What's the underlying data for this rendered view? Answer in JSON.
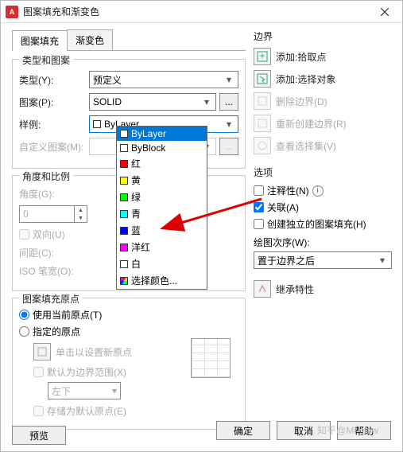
{
  "window": {
    "title": "图案填充和渐变色",
    "app_icon_text": "A"
  },
  "tabs": {
    "hatch": "图案填充",
    "gradient": "渐变色"
  },
  "type_group": {
    "title": "类型和图案",
    "type_label": "类型(Y):",
    "type_value": "预定义",
    "pattern_label": "图案(P):",
    "pattern_value": "SOLID",
    "sample_label": "样例:",
    "sample_value": "ByLayer",
    "custom_label": "自定义图案(M):"
  },
  "dropdown_items": [
    {
      "label": "ByLayer",
      "color": "#fff",
      "selected": true
    },
    {
      "label": "ByBlock",
      "color": "#fff"
    },
    {
      "label": "红",
      "color": "#ff0000"
    },
    {
      "label": "黄",
      "color": "#ffff00"
    },
    {
      "label": "绿",
      "color": "#00ff00"
    },
    {
      "label": "青",
      "color": "#00ffff"
    },
    {
      "label": "蓝",
      "color": "#0000ff"
    },
    {
      "label": "洋红",
      "color": "#ff00ff"
    },
    {
      "label": "白",
      "color": "#ffffff"
    },
    {
      "label": "选择颜色...",
      "color": null
    }
  ],
  "angle_group": {
    "title": "角度和比例",
    "angle_label": "角度(G):",
    "angle_value": "0",
    "double_label": "双向(U)",
    "spacing_label": "间距(C):",
    "iso_label": "ISO 笔宽(O):"
  },
  "origin_group": {
    "title": "图案填充原点",
    "use_current": "使用当前原点(T)",
    "specified": "指定的原点",
    "click_set": "单击以设置新原点",
    "default_bound": "默认为边界范围(X)",
    "leftbelow": "左下",
    "store_default": "存储为默认原点(E)"
  },
  "boundary": {
    "title": "边界",
    "add_pick": "添加:拾取点",
    "add_select": "添加:选择对象",
    "delete": "删除边界(D)",
    "recreate": "重新创建边界(R)",
    "view_sel": "查看选择集(V)"
  },
  "options": {
    "title": "选项",
    "annotative": "注释性(N)",
    "associative": "关联(A)",
    "independent": "创建独立的图案填充(H)",
    "draw_order_label": "绘图次序(W):",
    "draw_order_value": "置于边界之后"
  },
  "inherit": {
    "label": "继承特性"
  },
  "buttons": {
    "preview": "预览",
    "ok": "确定",
    "cancel": "取消",
    "help": "帮助"
  },
  "watermark": "知乎@Mr.slow"
}
